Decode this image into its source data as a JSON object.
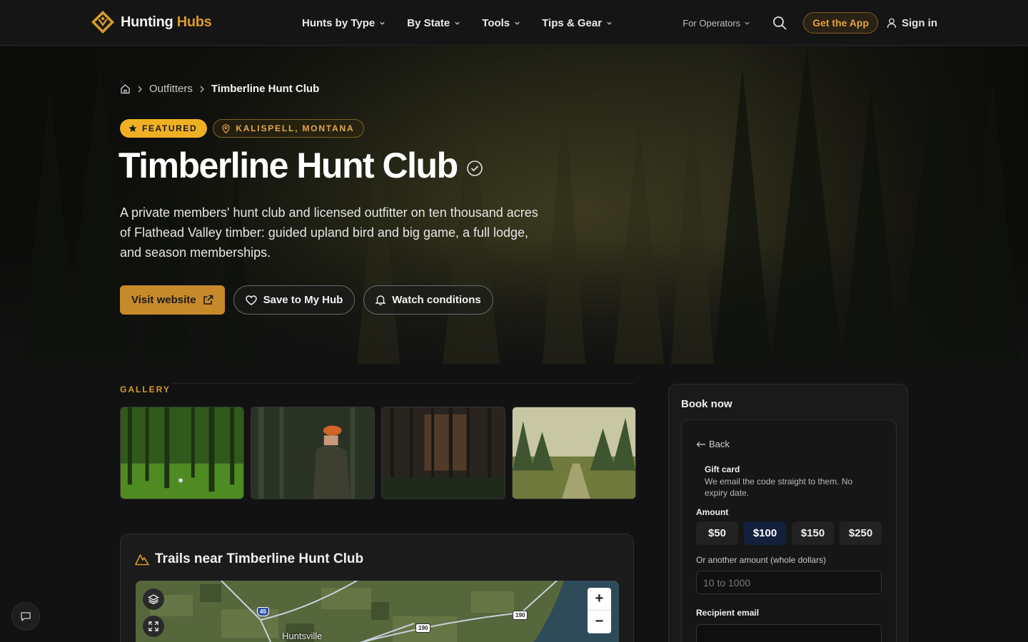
{
  "header": {
    "logo_word1": "Hunting",
    "logo_word2": "Hubs",
    "nav": [
      {
        "label": "Hunts by Type"
      },
      {
        "label": "By State"
      },
      {
        "label": "Tools"
      },
      {
        "label": "Tips & Gear"
      }
    ],
    "for_operators": "For Operators",
    "get_app": "Get the App",
    "sign_in": "Sign in"
  },
  "breadcrumb": {
    "items": [
      "Outfitters"
    ],
    "current": "Timberline Hunt Club"
  },
  "hero": {
    "badge_featured": "FEATURED",
    "badge_location": "KALISPELL, MONTANA",
    "title": "Timberline Hunt Club",
    "description": "A private members' hunt club and licensed outfitter on ten thousand acres of Flathead Valley timber: guided upland bird and big game, a full lodge, and season memberships.",
    "actions": {
      "visit": "Visit website",
      "save": "Save to My Hub",
      "watch": "Watch conditions"
    }
  },
  "gallery": {
    "label": "GALLERY",
    "thumb_count_note": ""
  },
  "trails": {
    "title": "Trails near Timberline Hunt Club",
    "map": {
      "town": "Huntsville",
      "shields": [
        "45",
        "190",
        "190"
      ]
    }
  },
  "booking": {
    "title": "Book now",
    "back": "Back",
    "gift_title": "Gift card",
    "gift_desc": "We email the code straight to them. No expiry date.",
    "amount_label": "Amount",
    "amounts": [
      "$50",
      "$100",
      "$150",
      "$250"
    ],
    "selected_amount": "$100",
    "other_label": "Or another amount (whole dollars)",
    "other_placeholder": "10 to 1000",
    "recipient_label": "Recipient email"
  },
  "colors": {
    "accent": "#d99a2b",
    "featured": "#f0b023",
    "primary_button": "#c78a2a",
    "selected_amount_bg": "#13203d"
  },
  "icons": {
    "logo": "hunting-hubs-logo-icon",
    "search": "search-icon",
    "user": "user-icon",
    "home": "home-icon",
    "star": "star-icon",
    "pin": "map-pin-icon",
    "verified": "verified-badge-icon",
    "external": "external-link-icon",
    "heart": "heart-icon",
    "bell": "bell-icon",
    "mountain": "mountain-icon",
    "layers": "layers-icon",
    "fullscreen": "fullscreen-icon",
    "chat": "chat-icon"
  }
}
